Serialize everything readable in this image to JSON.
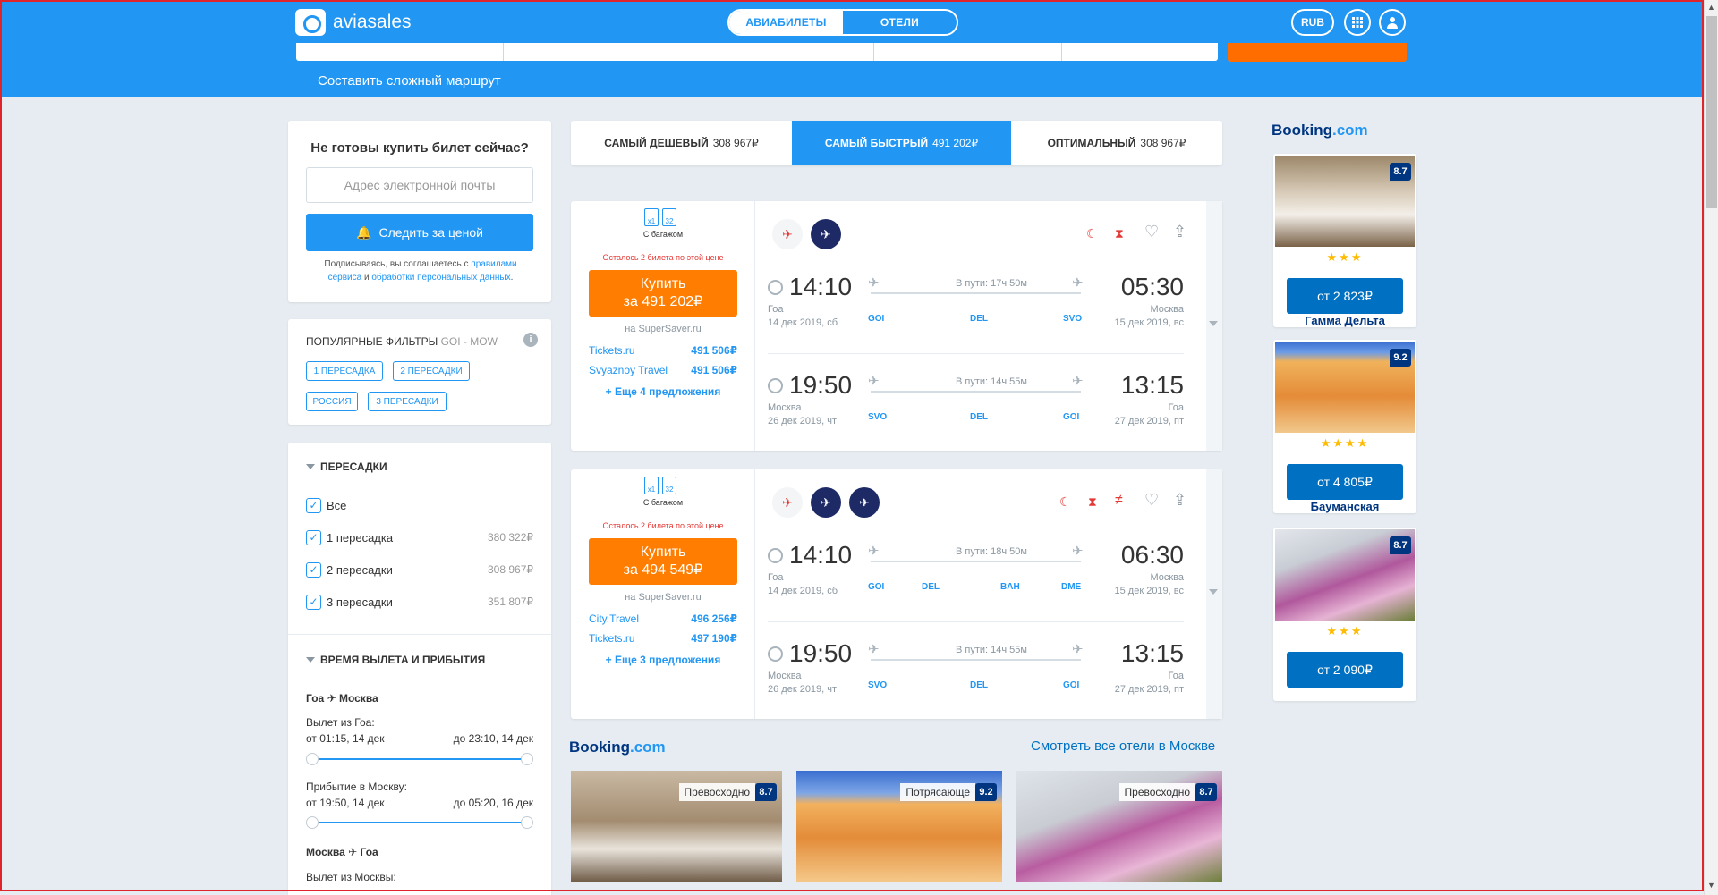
{
  "header": {
    "brand": "aviasales",
    "tabs": [
      {
        "label": "АВИАБИЛЕТЫ",
        "active": true
      },
      {
        "label": "ОТЕЛИ",
        "active": false
      }
    ],
    "currency": "RUB",
    "complex_route": "Составить сложный маршрут"
  },
  "track": {
    "title": "Не готовы купить билет сейчас?",
    "email_placeholder": "Адрес электронной почты",
    "button": "Следить за ценой",
    "agree_prefix": "Подписываясь, вы соглашаетесь с",
    "agree_link1": "правилами сервиса",
    "agree_mid": "и",
    "agree_link2": "обработки персональных данных",
    "agree_end": "."
  },
  "popular": {
    "title": "ПОПУЛЯРНЫЕ ФИЛЬТРЫ",
    "route": "GOI - MOW",
    "info": "i",
    "chips": [
      "1 ПЕРЕСАДКА",
      "2 ПЕРЕСАДКИ",
      "РОССИЯ",
      "3 ПЕРЕСАДКИ"
    ]
  },
  "filters": {
    "transfers_title": "ПЕРЕСАДКИ",
    "transfers": [
      {
        "label": "Все",
        "price": "",
        "checked": true
      },
      {
        "label": "1 пересадка",
        "price": "380 322₽",
        "checked": true
      },
      {
        "label": "2 пересадки",
        "price": "308 967₽",
        "checked": true
      },
      {
        "label": "3 пересадки",
        "price": "351 807₽",
        "checked": true
      }
    ],
    "time_title": "ВРЕМЯ ВЫЛЕТА И ПРИБЫТИЯ",
    "leg1_from": "Гоа",
    "leg1_to": "Москва",
    "dep_label": "Вылет из Гоа:",
    "dep_from": "от 01:15, 14 дек",
    "dep_to": "до 23:10, 14 дек",
    "arr_label": "Прибытие в Москву:",
    "arr_from": "от 19:50, 14 дек",
    "arr_to": "до 05:20, 16 дек",
    "leg2_from": "Москва",
    "leg2_to": "Гоа",
    "dep2_label": "Вылет из Москвы:"
  },
  "sort": [
    {
      "label": "САМЫЙ ДЕШЕВЫЙ",
      "price": "308 967₽",
      "active": false
    },
    {
      "label": "САМЫЙ БЫСТРЫЙ",
      "price": "491 202₽",
      "active": true
    },
    {
      "label": "ОПТИМАЛЬНЫЙ",
      "price": "308 967₽",
      "active": false
    }
  ],
  "tickets": [
    {
      "bag1": "x1",
      "bag2": "32",
      "baggage": "С багажом",
      "warning": "Осталось 2 билета по этой цене",
      "buy": "Купить",
      "price": "за 491 202₽",
      "agent": "на SuperSaver.ru",
      "offers": [
        {
          "name": "Tickets.ru",
          "price": "491 506₽"
        },
        {
          "name": "Svyaznoy Travel",
          "price": "491 506₽"
        }
      ],
      "more": "+ Еще 4 предложения",
      "segments": [
        {
          "dep": "14:10",
          "arr": "05:30",
          "dur": "В пути: 17ч 50м",
          "from_city": "Гоа",
          "from_date": "14 дек 2019, сб",
          "to_city": "Москва",
          "to_date": "15 дек 2019, вс",
          "iata": [
            "GOI",
            "DEL",
            "SVO"
          ]
        },
        {
          "dep": "19:50",
          "arr": "13:15",
          "dur": "В пути: 14ч 55м",
          "from_city": "Москва",
          "from_date": "26 дек 2019, чт",
          "to_city": "Гоа",
          "to_date": "27 дек 2019, пт",
          "iata": [
            "SVO",
            "DEL",
            "GOI"
          ]
        }
      ]
    },
    {
      "bag1": "x1",
      "bag2": "32",
      "baggage": "С багажом",
      "warning": "Осталось 2 билета по этой цене",
      "buy": "Купить",
      "price": "за 494 549₽",
      "agent": "на SuperSaver.ru",
      "offers": [
        {
          "name": "City.Travel",
          "price": "496 256₽"
        },
        {
          "name": "Tickets.ru",
          "price": "497 190₽"
        }
      ],
      "more": "+ Еще 3 предложения",
      "segments": [
        {
          "dep": "14:10",
          "arr": "06:30",
          "dur": "В пути: 18ч 50м",
          "from_city": "Гоа",
          "from_date": "14 дек 2019, сб",
          "to_city": "Москва",
          "to_date": "15 дек 2019, вс",
          "iata": [
            "GOI",
            "DEL",
            "BAH",
            "DME"
          ]
        },
        {
          "dep": "19:50",
          "arr": "13:15",
          "dur": "В пути: 14ч 55м",
          "from_city": "Москва",
          "from_date": "26 дек 2019, чт",
          "to_city": "Гоа",
          "to_date": "27 дек 2019, пт",
          "iata": [
            "SVO",
            "DEL",
            "GOI"
          ]
        }
      ]
    }
  ],
  "booking": {
    "brand": "Booking",
    "brand_suffix": ".com",
    "see_all": "Смотреть все отели в Москве",
    "side_hotels": [
      {
        "score": "8.7",
        "stars": "★★★",
        "price": "от 2 823₽",
        "name": "Гамма Дельта"
      },
      {
        "score": "9.2",
        "stars": "★★★★",
        "price": "от 4 805₽",
        "name": "Бауманская"
      },
      {
        "score": "8.7",
        "stars": "★★★",
        "price": "от 2 090₽",
        "name": ""
      }
    ],
    "bottom_hotels": [
      {
        "tag": "Превосходно",
        "score": "8.7"
      },
      {
        "tag": "Потрясающе",
        "score": "9.2"
      },
      {
        "tag": "Превосходно",
        "score": "8.7"
      }
    ]
  },
  "colors": {
    "accent": "#2196f3",
    "buy": "#ff7d00",
    "booking": "#003580",
    "warning": "#e53935"
  }
}
